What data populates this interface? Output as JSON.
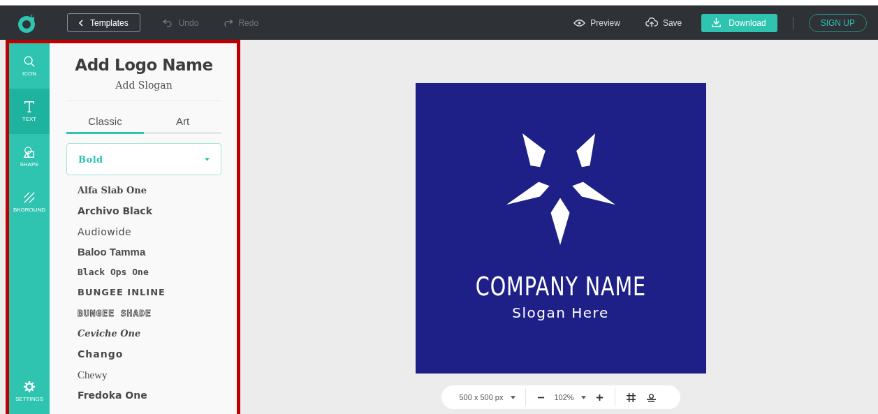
{
  "topbar": {
    "templates_button": "Templates",
    "undo": {
      "label": "Undo",
      "disabled": true
    },
    "redo": {
      "label": "Redo",
      "disabled": true
    },
    "preview": "Preview",
    "save": "Save",
    "download": "Download",
    "signup": "SIGN UP"
  },
  "rail": [
    {
      "kind": "search",
      "label": "ICON",
      "selected": false
    },
    {
      "kind": "text",
      "label": "TEXT",
      "selected": true
    },
    {
      "kind": "shape",
      "label": "SHAPE",
      "selected": false
    },
    {
      "kind": "background",
      "label": "BKGROUND",
      "selected": false
    }
  ],
  "rail_settings": {
    "label": "SETTINGS"
  },
  "panel": {
    "logo_name": "Add Logo Name",
    "slogan": "Add Slogan",
    "tabs": [
      {
        "label": "Classic",
        "selected": true
      },
      {
        "label": "Art",
        "selected": false
      }
    ],
    "category": "Bold",
    "fonts": [
      "Alfa Slab One",
      "Archivo Black",
      "Audiowide",
      "Baloo Tamma",
      "Black Ops One",
      "BUNGEE INLINE",
      "BUNGEE SHADE",
      "Ceviche One",
      "Chango",
      "Chewy",
      "Fredoka One"
    ]
  },
  "logo": {
    "company_name": "COMPANY NAME",
    "slogan": "Slogan Here"
  },
  "canvas_toolbar": {
    "size": "500 x 500 px",
    "zoom": "102%"
  }
}
